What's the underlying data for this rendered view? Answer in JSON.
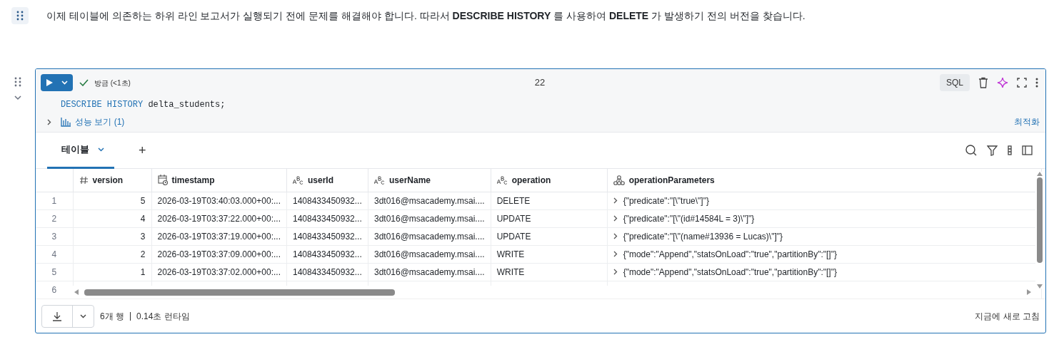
{
  "intro": "이제 테이블에 의존하는 하위 라인 보고서가 실행되기 전에 문제를 해결해야 합니다. 따라서 **DESCRIBE HISTORY** 를 사용하여 **DELETE** 가 발생하기 전의 버전을 찾습니다.",
  "cell": {
    "status": "방금 (<1초)",
    "cell_number": "22",
    "language": "SQL",
    "code": [
      {
        "kind": "keyword",
        "text": "DESCRIBE HISTORY"
      },
      {
        "kind": "plain",
        "text": " delta_students;"
      }
    ],
    "performance_link": "성능 보기 (1)",
    "optimize_link": "최적화"
  },
  "result_tabs": [
    {
      "label": "테이블",
      "selected": true
    }
  ],
  "add_tab": "+",
  "table": {
    "columns": [
      {
        "label": "version",
        "kind": "number"
      },
      {
        "label": "timestamp",
        "kind": "date"
      },
      {
        "label": "userId",
        "kind": "string"
      },
      {
        "label": "userName",
        "kind": "string"
      },
      {
        "label": "operation",
        "kind": "string"
      },
      {
        "label": "operationParameters",
        "kind": "struct"
      }
    ],
    "rows": [
      {
        "number": "1",
        "cells": [
          "5",
          "2026-03-19T03:40:03.000+00:...",
          "1408433450932...",
          "3dt016@msacademy.msai....",
          "DELETE",
          "{\"predicate\":\"[\\\"true\\\"]\"}"
        ]
      },
      {
        "number": "2",
        "cells": [
          "4",
          "2026-03-19T03:37:22.000+00:...",
          "1408433450932...",
          "3dt016@msacademy.msai....",
          "UPDATE",
          "{\"predicate\":\"[\\\"(id#14584L = 3)\\\"]\"}"
        ]
      },
      {
        "number": "3",
        "cells": [
          "3",
          "2026-03-19T03:37:19.000+00:...",
          "1408433450932...",
          "3dt016@msacademy.msai....",
          "UPDATE",
          "{\"predicate\":\"[\\\"(name#13936 = Lucas)\\\"]\"}"
        ]
      },
      {
        "number": "4",
        "cells": [
          "2",
          "2026-03-19T03:37:09.000+00:...",
          "1408433450932...",
          "3dt016@msacademy.msai....",
          "WRITE",
          "{\"mode\":\"Append\",\"statsOnLoad\":\"true\",\"partitionBy\":\"[]\"}"
        ]
      },
      {
        "number": "5",
        "cells": [
          "1",
          "2026-03-19T03:37:02.000+00:...",
          "1408433450932...",
          "3dt016@msacademy.msai....",
          "WRITE",
          "{\"mode\":\"Append\",\"statsOnLoad\":\"true\",\"partitionBy\":\"[]\"}"
        ]
      },
      {
        "number": "6",
        "cells": []
      }
    ]
  },
  "footer": {
    "row_count": "6개 행",
    "runtime": "0.14초 런타임",
    "refresh": "지금에 새로 고침"
  }
}
